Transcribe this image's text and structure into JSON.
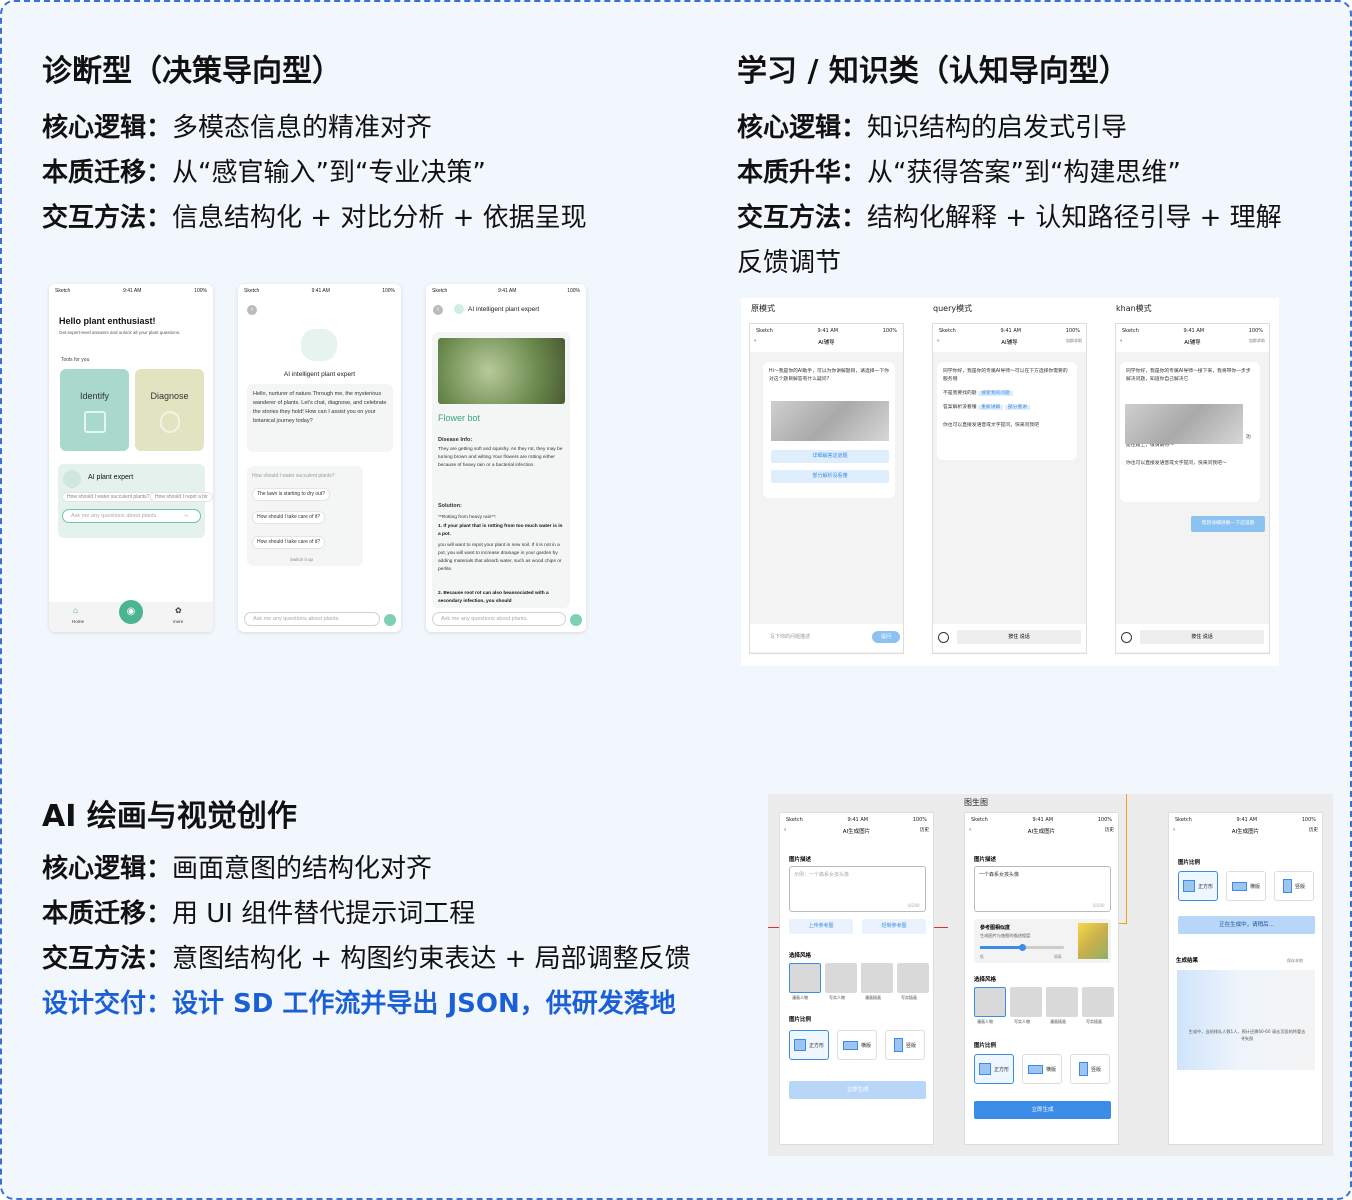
{
  "s1": {
    "title": "诊断型（决策导向型）",
    "l1k": "核心逻辑：",
    "l1v": "多模态信息的精准对齐",
    "l2k": "本质迁移：",
    "l2v": "从“感官输入”到“专业决策”",
    "l3k": "交互方法：",
    "l3v": "信息结构化 + 对比分析 + 依据呈现"
  },
  "s2": {
    "title": "学习 / 知识类（认知导向型）",
    "l1k": "核心逻辑：",
    "l1v": "知识结构的启发式引导",
    "l2k": "本质升华：",
    "l2v": "从“获得答案”到“构建思维”",
    "l3k": "交互方法：",
    "l3v": "结构化解释 + 认知路径引导 + 理解",
    "l4": "反馈调节"
  },
  "s3": {
    "title": "AI 绘画与视觉创作",
    "l1k": "核心逻辑：",
    "l1v": "画面意图的结构化对齐",
    "l2k": "本质迁移：",
    "l2v": "用 UI 组件替代提示词工程",
    "l3k": "交互方法：",
    "l3v": "意图结构化 + 构图约束表达 + 局部调整反馈",
    "l4": "设计交付：设计 SD 工作流并导出 JSON，供研发落地"
  },
  "plant": {
    "status_left": "Sketch",
    "status_time": "9:41 AM",
    "status_batt": "100%",
    "p1": {
      "hello": "Hello plant enthusiast!",
      "sub": "Get expert-level answers and unlock all your plant questions.",
      "tools": "Tools for you",
      "identify": "Identify",
      "diagnose": "Diagnose",
      "expert": "AI plant expert",
      "chip1": "How should I water succulent plants?",
      "chip2": "How should I repot a bir",
      "ask": "Ask me any questions about plants.",
      "nav_home": "Home",
      "nav_more": "more"
    },
    "p2": {
      "title": "AI intelligent plant expert",
      "intro": "Hello, nurturer of nature.Through me, the mysterious wanderer of plants. Let's chat, diagnose, and celebrate the stories they hold! How can I assist you on your botanical journey today?",
      "q0": "How should I water succulent plants?",
      "q1": "The lawn is starting to dry out?",
      "q2": "How should I take care of it?",
      "q3": "How should I take care of it?",
      "switch": "Switch it up",
      "ask": "Ask me any questions about plants."
    },
    "p3": {
      "title": "AI intelligent plant expert",
      "bot": "Flower bot",
      "info_h": "Disease Info:",
      "info": "They are getting soft and squishy. As they rot, they may be turning brown and wilting.Your flowers are rotting either because of heavy rain or a bacterial infection.",
      "sol_h": "Solution:",
      "sol1": "**Rotting from heavy rain**:",
      "sol2": "1. If your plant that is rotting from too much water is in a pot.",
      "sol3": "you will want to repot your plant in new soil. If it is not in a pot, you will want to increase drainage in your garden by adding materials that absorb water, such as wood chips or perlite.",
      "sol4": "2. Because root rot can also beassociated with a secondary infection, you should",
      "ask": "Ask me any questions about plants."
    }
  },
  "learn": {
    "m1": "原模式",
    "m2": "query模式",
    "m3": "khan模式",
    "header": "AI辅导",
    "hist": "加群求助",
    "f1msg": "Hi～我是你的AI助手，可以为你讲解题目，请选择一下你对这个题目解答有什么疑问?",
    "f1b1": "详细解答这道题",
    "f1b2": "部分解析没看懂",
    "f1inp": "写下你的问题描述",
    "f1send": "提问",
    "f2msg": "同学你好，我是你的专属AI导师～可以在下方选择你需要的服务哦",
    "f2q1": "不是我要找的题",
    "f2b1": "搜索我的问题",
    "f2q2": "答案解析没看懂",
    "f2b2": "重新讲解",
    "f2b3": "部分重讲",
    "f2msg2": "你也可以直接发语音或文字提问，快来问我吧",
    "f2hold": "按住 说话",
    "f3msg": "同学你好，我是你的专属AI导师～接下来，我将带你一步步解决问题，知道你自己解决它",
    "f3msg2": "如果这道题不是你想搜的题目，我们暂时还无法解答哦，功能在路上，敬请期待～",
    "f3msg3": "你也可以直接发语音或文字提问，快来问我吧～",
    "f3reply": "帮我详细讲解一下这道题",
    "f3hold": "按住 说话"
  },
  "draw": {
    "top": "图生图",
    "header": "AI生成图片",
    "hist": "历史",
    "desc_l": "图片描述",
    "desc_ph": "示例：一个森系女孩头像",
    "desc_v": "一个森系女孩头像",
    "count": "0/200",
    "up1": "上传参考图",
    "up2": "轻制参考图",
    "ref_t": "参考图相似度",
    "ref_s": "生成图片与垫图的描述程度",
    "low": "低",
    "high": "较高",
    "style_l": "选择风格",
    "styles": [
      "漫画人物",
      "写实人物",
      "漫画插画",
      "写实插画"
    ],
    "ratio_l": "图片比例",
    "r1": "正方形",
    "r2": "横版",
    "r3": "竖版",
    "gen": "立即生成",
    "gen_busy": "正在生成中，请稍后...",
    "result_l": "生成结果",
    "save": "保存本地",
    "wait": "生成中，当前排队人数1人，预计还需60-60 请去页面的将要去寻失照"
  }
}
